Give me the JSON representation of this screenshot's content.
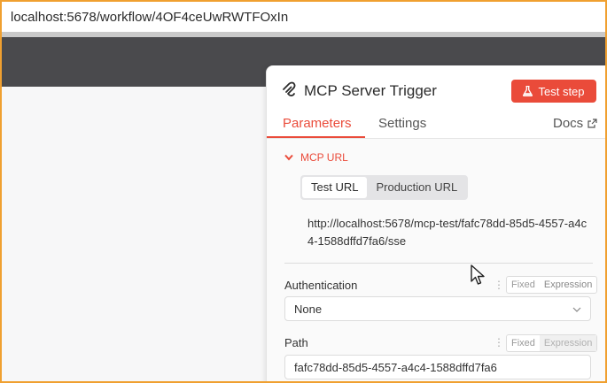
{
  "browser": {
    "url": "localhost:5678/workflow/4OF4ceUwRWTFOxIn"
  },
  "panel": {
    "title": "MCP Server Trigger",
    "test_step_label": "Test step",
    "tabs": [
      {
        "label": "Parameters",
        "active": true
      },
      {
        "label": "Settings",
        "active": false
      }
    ],
    "docs_label": "Docs",
    "section": {
      "label": "MCP URL",
      "url_tabs": [
        {
          "label": "Test URL",
          "active": true
        },
        {
          "label": "Production URL",
          "active": false
        }
      ],
      "url_value": "http://localhost:5678/mcp-test/fafc78dd-85d5-4557-a4c4-1588dffd7fa6/sse"
    },
    "fields": {
      "authentication": {
        "label": "Authentication",
        "value": "None",
        "mode_fixed": "Fixed",
        "mode_expression": "Expression"
      },
      "path": {
        "label": "Path",
        "value": "fafc78dd-85d5-4557-a4c4-1588dffd7fa6",
        "mode_fixed": "Fixed",
        "mode_expression": "Expression"
      }
    }
  },
  "colors": {
    "accent": "#ea4b3a",
    "dark_band": "#4a4a4d",
    "frame_border": "#f0a030"
  }
}
